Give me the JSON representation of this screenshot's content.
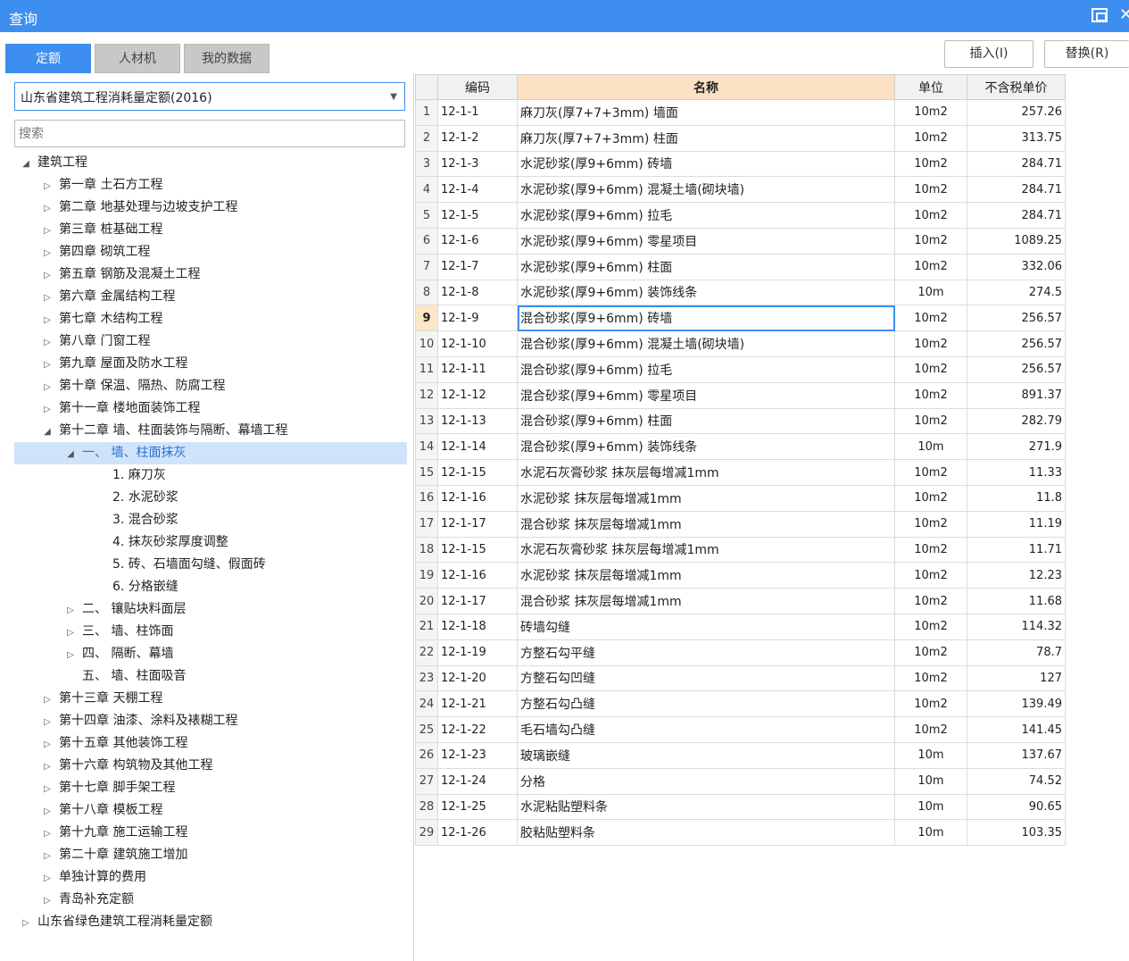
{
  "window": {
    "title": "查询"
  },
  "tabs": [
    {
      "label": "定额",
      "active": true
    },
    {
      "label": "人材机",
      "active": false
    },
    {
      "label": "我的数据",
      "active": false
    }
  ],
  "toolbar": {
    "insert_label": "插入(I)",
    "replace_label": "替换(R)"
  },
  "library": {
    "selected": "山东省建筑工程消耗量定额(2016)"
  },
  "search": {
    "placeholder": "搜索"
  },
  "tree": [
    {
      "label": "建筑工程",
      "level": 0,
      "arrow": "expanded"
    },
    {
      "label": "第一章 土石方工程",
      "level": 1,
      "arrow": "collapsed"
    },
    {
      "label": "第二章 地基处理与边坡支护工程",
      "level": 1,
      "arrow": "collapsed"
    },
    {
      "label": "第三章 桩基础工程",
      "level": 1,
      "arrow": "collapsed"
    },
    {
      "label": "第四章 砌筑工程",
      "level": 1,
      "arrow": "collapsed"
    },
    {
      "label": "第五章 钢筋及混凝土工程",
      "level": 1,
      "arrow": "collapsed"
    },
    {
      "label": "第六章 金属结构工程",
      "level": 1,
      "arrow": "collapsed"
    },
    {
      "label": "第七章 木结构工程",
      "level": 1,
      "arrow": "collapsed"
    },
    {
      "label": "第八章 门窗工程",
      "level": 1,
      "arrow": "collapsed"
    },
    {
      "label": "第九章 屋面及防水工程",
      "level": 1,
      "arrow": "collapsed"
    },
    {
      "label": "第十章 保温、隔热、防腐工程",
      "level": 1,
      "arrow": "collapsed"
    },
    {
      "label": "第十一章 楼地面装饰工程",
      "level": 1,
      "arrow": "collapsed"
    },
    {
      "label": "第十二章 墙、柱面装饰与隔断、幕墙工程",
      "level": 1,
      "arrow": "expanded"
    },
    {
      "label": "一、 墙、柱面抹灰",
      "level": 2,
      "arrow": "expanded",
      "selected": true
    },
    {
      "label": "1. 麻刀灰",
      "level": 4,
      "arrow": "none"
    },
    {
      "label": "2. 水泥砂浆",
      "level": 4,
      "arrow": "none"
    },
    {
      "label": "3. 混合砂浆",
      "level": 4,
      "arrow": "none"
    },
    {
      "label": "4. 抹灰砂浆厚度调整",
      "level": 4,
      "arrow": "none"
    },
    {
      "label": "5. 砖、石墙面勾缝、假面砖",
      "level": 4,
      "arrow": "none"
    },
    {
      "label": "6. 分格嵌缝",
      "level": 4,
      "arrow": "none"
    },
    {
      "label": "二、 镶贴块料面层",
      "level": 2,
      "arrow": "collapsed"
    },
    {
      "label": "三、 墙、柱饰面",
      "level": 2,
      "arrow": "collapsed"
    },
    {
      "label": "四、 隔断、幕墙",
      "level": 2,
      "arrow": "collapsed"
    },
    {
      "label": "五、 墙、柱面吸音",
      "level": 2,
      "arrow": "none"
    },
    {
      "label": "第十三章 天棚工程",
      "level": 1,
      "arrow": "collapsed"
    },
    {
      "label": "第十四章 油漆、涂料及裱糊工程",
      "level": 1,
      "arrow": "collapsed"
    },
    {
      "label": "第十五章 其他装饰工程",
      "level": 1,
      "arrow": "collapsed"
    },
    {
      "label": "第十六章 构筑物及其他工程",
      "level": 1,
      "arrow": "collapsed"
    },
    {
      "label": "第十七章 脚手架工程",
      "level": 1,
      "arrow": "collapsed"
    },
    {
      "label": "第十八章 模板工程",
      "level": 1,
      "arrow": "collapsed"
    },
    {
      "label": "第十九章 施工运输工程",
      "level": 1,
      "arrow": "collapsed"
    },
    {
      "label": "第二十章 建筑施工增加",
      "level": 1,
      "arrow": "collapsed"
    },
    {
      "label": "单独计算的费用",
      "level": 1,
      "arrow": "collapsed"
    },
    {
      "label": "青岛补充定额",
      "level": 1,
      "arrow": "collapsed"
    },
    {
      "label": "山东省绿色建筑工程消耗量定额",
      "level": 0,
      "arrow": "collapsed"
    }
  ],
  "grid": {
    "columns": [
      "编码",
      "名称",
      "单位",
      "不含税单价"
    ],
    "active_row": 9,
    "rows": [
      {
        "num": "1",
        "code": "12-1-1",
        "name": "麻刀灰(厚7+7+3mm) 墙面",
        "unit": "10m2",
        "price": "257.26"
      },
      {
        "num": "2",
        "code": "12-1-2",
        "name": "麻刀灰(厚7+7+3mm) 柱面",
        "unit": "10m2",
        "price": "313.75"
      },
      {
        "num": "3",
        "code": "12-1-3",
        "name": "水泥砂浆(厚9+6mm) 砖墙",
        "unit": "10m2",
        "price": "284.71"
      },
      {
        "num": "4",
        "code": "12-1-4",
        "name": "水泥砂浆(厚9+6mm) 混凝土墙(砌块墙)",
        "unit": "10m2",
        "price": "284.71"
      },
      {
        "num": "5",
        "code": "12-1-5",
        "name": "水泥砂浆(厚9+6mm) 拉毛",
        "unit": "10m2",
        "price": "284.71"
      },
      {
        "num": "6",
        "code": "12-1-6",
        "name": "水泥砂浆(厚9+6mm) 零星项目",
        "unit": "10m2",
        "price": "1089.25"
      },
      {
        "num": "7",
        "code": "12-1-7",
        "name": "水泥砂浆(厚9+6mm) 柱面",
        "unit": "10m2",
        "price": "332.06"
      },
      {
        "num": "8",
        "code": "12-1-8",
        "name": "水泥砂浆(厚9+6mm) 装饰线条",
        "unit": "10m",
        "price": "274.5"
      },
      {
        "num": "9",
        "code": "12-1-9",
        "name": "混合砂浆(厚9+6mm) 砖墙",
        "unit": "10m2",
        "price": "256.57"
      },
      {
        "num": "10",
        "code": "12-1-10",
        "name": "混合砂浆(厚9+6mm) 混凝土墙(砌块墙)",
        "unit": "10m2",
        "price": "256.57"
      },
      {
        "num": "11",
        "code": "12-1-11",
        "name": "混合砂浆(厚9+6mm) 拉毛",
        "unit": "10m2",
        "price": "256.57"
      },
      {
        "num": "12",
        "code": "12-1-12",
        "name": "混合砂浆(厚9+6mm) 零星项目",
        "unit": "10m2",
        "price": "891.37"
      },
      {
        "num": "13",
        "code": "12-1-13",
        "name": "混合砂浆(厚9+6mm) 柱面",
        "unit": "10m2",
        "price": "282.79"
      },
      {
        "num": "14",
        "code": "12-1-14",
        "name": "混合砂浆(厚9+6mm) 装饰线条",
        "unit": "10m",
        "price": "271.9"
      },
      {
        "num": "15",
        "code": "12-1-15",
        "name": "水泥石灰膏砂浆 抹灰层每增减1mm",
        "unit": "10m2",
        "price": "11.33"
      },
      {
        "num": "16",
        "code": "12-1-16",
        "name": "水泥砂浆 抹灰层每增减1mm",
        "unit": "10m2",
        "price": "11.8"
      },
      {
        "num": "17",
        "code": "12-1-17",
        "name": "混合砂浆 抹灰层每增减1mm",
        "unit": "10m2",
        "price": "11.19"
      },
      {
        "num": "18",
        "code": "12-1-15",
        "name": "水泥石灰膏砂浆 抹灰层每增减1mm",
        "unit": "10m2",
        "price": "11.71"
      },
      {
        "num": "19",
        "code": "12-1-16",
        "name": "水泥砂浆 抹灰层每增减1mm",
        "unit": "10m2",
        "price": "12.23"
      },
      {
        "num": "20",
        "code": "12-1-17",
        "name": "混合砂浆 抹灰层每增减1mm",
        "unit": "10m2",
        "price": "11.68"
      },
      {
        "num": "21",
        "code": "12-1-18",
        "name": "砖墙勾缝",
        "unit": "10m2",
        "price": "114.32"
      },
      {
        "num": "22",
        "code": "12-1-19",
        "name": "方整石勾平缝",
        "unit": "10m2",
        "price": "78.7"
      },
      {
        "num": "23",
        "code": "12-1-20",
        "name": "方整石勾凹缝",
        "unit": "10m2",
        "price": "127"
      },
      {
        "num": "24",
        "code": "12-1-21",
        "name": "方整石勾凸缝",
        "unit": "10m2",
        "price": "139.49"
      },
      {
        "num": "25",
        "code": "12-1-22",
        "name": "毛石墙勾凸缝",
        "unit": "10m2",
        "price": "141.45"
      },
      {
        "num": "26",
        "code": "12-1-23",
        "name": "玻璃嵌缝",
        "unit": "10m",
        "price": "137.67"
      },
      {
        "num": "27",
        "code": "12-1-24",
        "name": "分格",
        "unit": "10m",
        "price": "74.52"
      },
      {
        "num": "28",
        "code": "12-1-25",
        "name": "水泥粘贴塑料条",
        "unit": "10m",
        "price": "90.65"
      },
      {
        "num": "29",
        "code": "12-1-26",
        "name": "胶粘贴塑料条",
        "unit": "10m",
        "price": "103.35"
      }
    ]
  },
  "colors": {
    "accent": "#3d8ef0",
    "header_highlight": "#fce2c2",
    "selection": "#cfe4fb"
  }
}
